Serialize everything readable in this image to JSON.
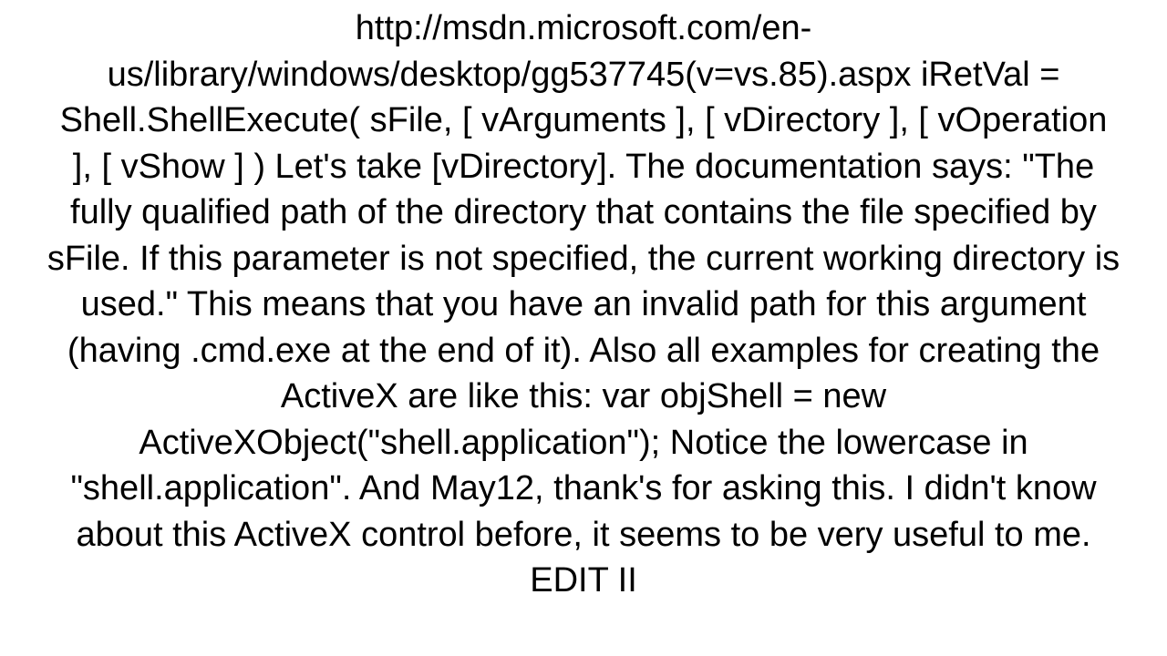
{
  "document": {
    "body": "http://msdn.microsoft.com/en-us/library/windows/desktop/gg537745(v=vs.85).aspx iRetVal = Shell.ShellExecute(   sFile,   [ vArguments ],   [ vDirectory ],   [ vOperation ],   [ vShow ] )  Let's take [vDirectory]. The documentation says: \"The fully qualified path of the directory that contains the file specified by sFile. If this parameter is not specified, the current working directory is used.\" This means that you have an invalid path for this argument (having .cmd.exe at the end of it). Also all examples for creating the ActiveX are like this: var objShell = new ActiveXObject(\"shell.application\"); Notice the lowercase in \"shell.application\". And May12, thank's for asking this. I didn't know about this ActiveX control before, it seems to be very useful to me. EDIT II"
  }
}
